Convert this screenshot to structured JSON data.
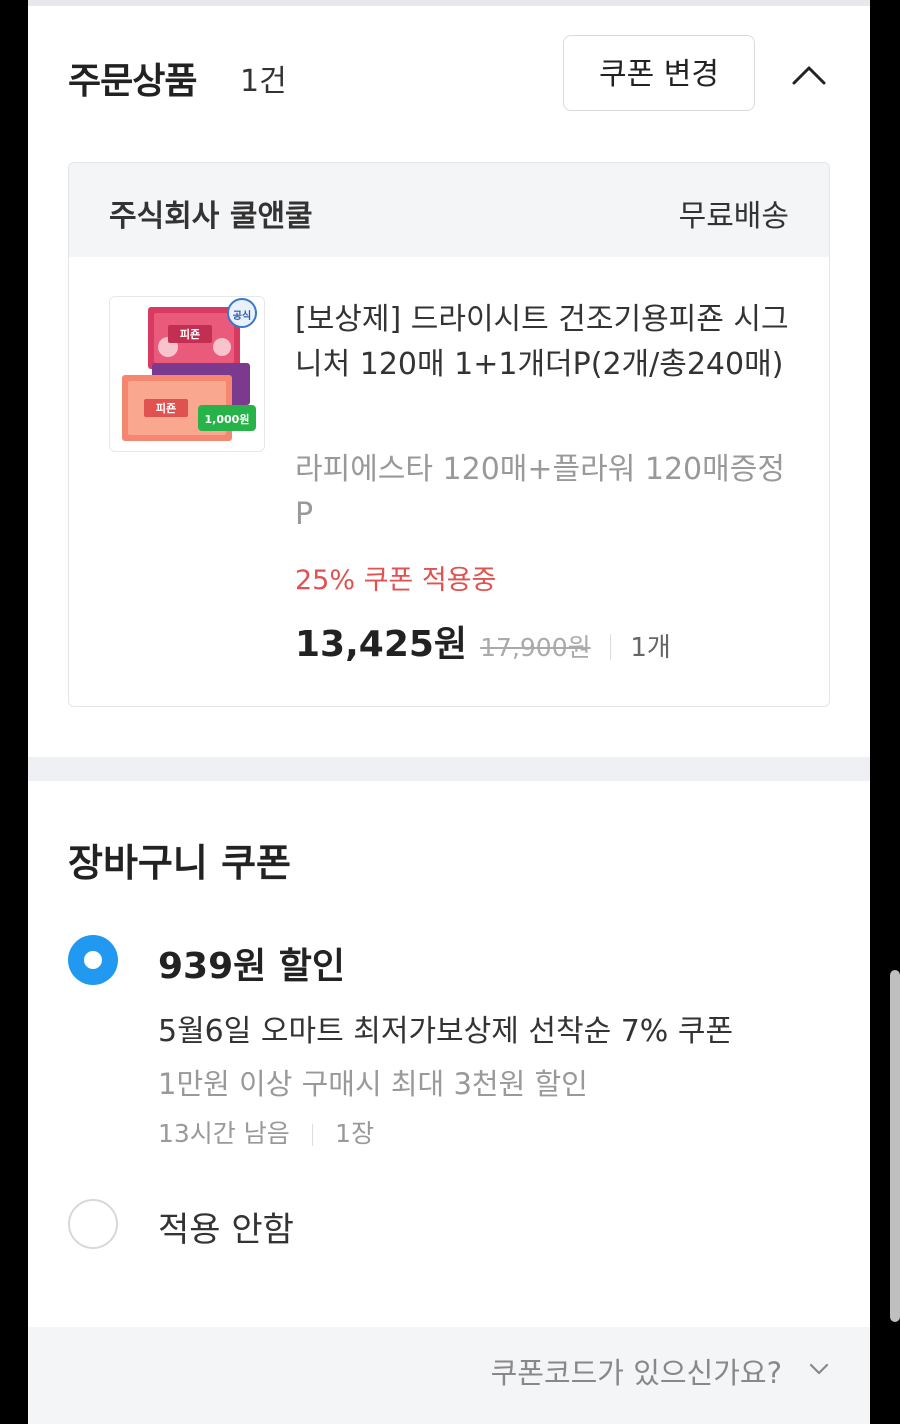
{
  "order": {
    "title": "주문상품",
    "count": "1건",
    "coupon_change_label": "쿠폰 변경",
    "collapse_icon": "chevron-up-icon"
  },
  "seller": {
    "name": "주식회사 쿨앤쿨",
    "shipping": "무료배송"
  },
  "product": {
    "thumb_badge": "공식",
    "thumb_brand": "피죤",
    "thumb_price_tag": "1,000원",
    "name": "[보상제] 드라이시트 건조기용피죤 시그니처 120매 1+1개더P(2개/총240매)",
    "option": "라피에스타 120매+플라워 120매증정P",
    "coupon_status": "25% 쿠폰 적용중",
    "price": "13,425원",
    "original_price": "17,900원",
    "quantity": "1개"
  },
  "cart_coupon": {
    "title": "장바구니 쿠폰",
    "options": [
      {
        "selected": true,
        "discount": "939원 할인",
        "name": "5월6일 오마트 최저가보상제 선착순 7% 쿠폰",
        "condition": "1만원 이상 구매시 최대 3천원 할인",
        "remaining": "13시간 남음",
        "count": "1장"
      },
      {
        "selected": false,
        "label": "적용 안함"
      }
    ]
  },
  "footer": {
    "code_link": "쿠폰코드가 있으신가요?",
    "code_icon": "chevron-down-icon"
  },
  "colors": {
    "accent_blue": "#2199f0",
    "coupon_red": "#e0524f",
    "section_bg": "#f4f5f7"
  }
}
